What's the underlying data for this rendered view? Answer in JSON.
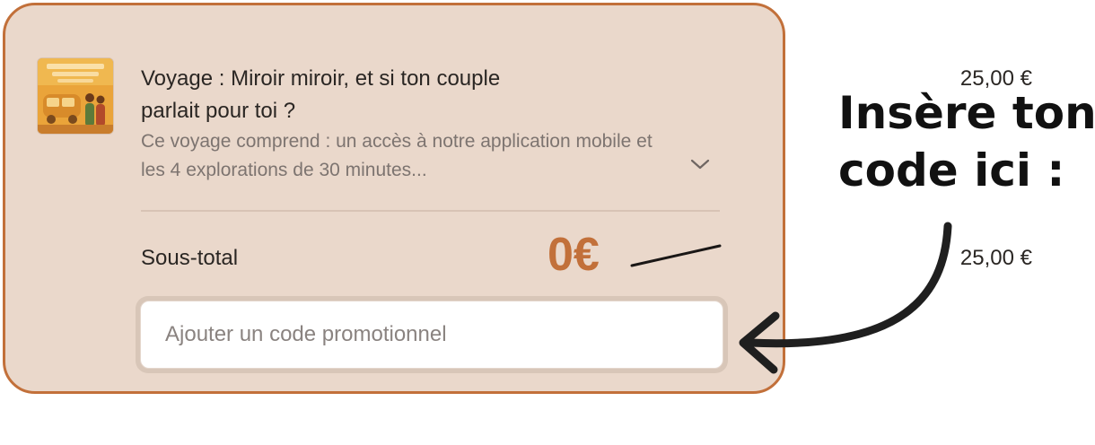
{
  "cart": {
    "item": {
      "title": "Voyage : Miroir miroir, et si ton couple parlait pour toi ?",
      "price": "25,00 €",
      "description": "Ce voyage comprend : un accès à notre application mobile et les 4 explorations de 30 minutes..."
    },
    "subtotal": {
      "label": "Sous-total",
      "new_price": "0€",
      "old_price": "25,00 €"
    },
    "promo": {
      "placeholder": "Ajouter un code promotionnel",
      "value": ""
    }
  },
  "callout": {
    "line1": "Insère ton",
    "line2": "code ici :"
  },
  "colors": {
    "card_background": "#ead8cb",
    "card_border": "#c2703a",
    "accent_price": "#c2703a",
    "text": "#2a2623",
    "muted_text": "#7d7470"
  },
  "icons": {
    "expand": "chevron-down-icon",
    "pointer": "curved-arrow-icon",
    "product_image": "product-thumbnail"
  }
}
